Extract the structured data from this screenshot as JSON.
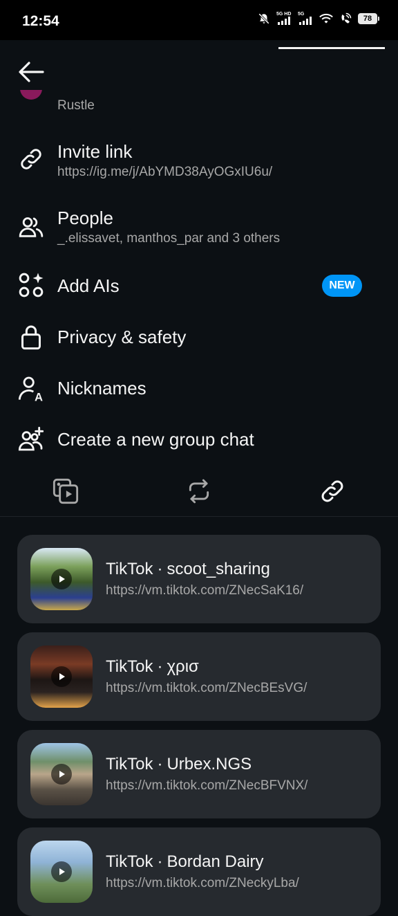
{
  "status_bar": {
    "time": "12:54",
    "network_1": "5G HD",
    "network_2": "5G",
    "battery": "78",
    "icons": [
      "mute-bell-icon",
      "signal-icon",
      "wifi-icon",
      "hotspot-icon",
      "battery-icon"
    ]
  },
  "header": {
    "back_icon": "arrow-left-icon"
  },
  "partial_item": {
    "subtitle": "Rustle"
  },
  "settings": {
    "invite": {
      "title": "Invite link",
      "subtitle": "https://ig.me/j/AbYMD38AyOGxIU6u/",
      "icon": "link-icon"
    },
    "people": {
      "title": "People",
      "subtitle": "_.elissavet, manthos_par and 3 others",
      "icon": "people-icon"
    },
    "add_ais": {
      "title": "Add AIs",
      "badge": "NEW",
      "icon": "add-ai-icon"
    },
    "privacy": {
      "title": "Privacy & safety",
      "icon": "lock-icon"
    },
    "nicknames": {
      "title": "Nicknames",
      "icon": "nickname-icon"
    },
    "new_group": {
      "title": "Create a new group chat",
      "icon": "add-people-icon"
    }
  },
  "tabs": [
    {
      "name": "media",
      "icon": "media-icon",
      "active": false
    },
    {
      "name": "reels",
      "icon": "repost-icon",
      "active": false
    },
    {
      "name": "links",
      "icon": "link-icon",
      "active": true
    }
  ],
  "links": [
    {
      "source": "TikTok",
      "separator": "·",
      "author": "scoot_sharing",
      "url": "https://vm.tiktok.com/ZNecSaK16/"
    },
    {
      "source": "TikTok",
      "separator": "·",
      "author": "χρισ",
      "url": "https://vm.tiktok.com/ZNecBEsVG/"
    },
    {
      "source": "TikTok",
      "separator": "·",
      "author": "Urbex.NGS",
      "url": "https://vm.tiktok.com/ZNecBFVNX/"
    },
    {
      "source": "TikTok",
      "separator": "·",
      "author": "Bordan Dairy",
      "url": "https://vm.tiktok.com/ZNeckyLba/"
    }
  ],
  "colors": {
    "background": "#0c1014",
    "card": "#262a2f",
    "accent": "#0095f6",
    "secondary_text": "#a8a8a8"
  }
}
